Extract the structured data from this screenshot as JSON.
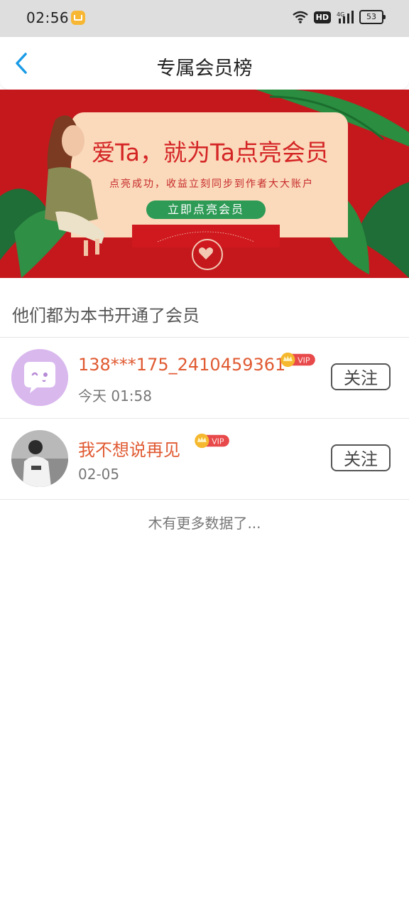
{
  "status": {
    "time": "02:56",
    "battery": "53"
  },
  "nav": {
    "title": "专属会员榜"
  },
  "banner": {
    "headline": "爱Ta，就为Ta点亮会员",
    "subtitle": "点亮成功，收益立刻同步到作者大大账户",
    "button_label": "立即点亮会员"
  },
  "section": {
    "title": "他们都为本书开通了会员"
  },
  "members": [
    {
      "name": "138***175_2410459361",
      "time": "今天 01:58",
      "badge": "VIP",
      "follow_label": "关注"
    },
    {
      "name": "我不想说再见",
      "time": "02-05",
      "badge": "VIP",
      "follow_label": "关注"
    }
  ],
  "footer": {
    "no_more": "木有更多数据了..."
  },
  "colors": {
    "accent_blue": "#1a9be6",
    "banner_red": "#c4181d",
    "name_orange": "#e05a32",
    "vip_red": "#e8494a"
  }
}
